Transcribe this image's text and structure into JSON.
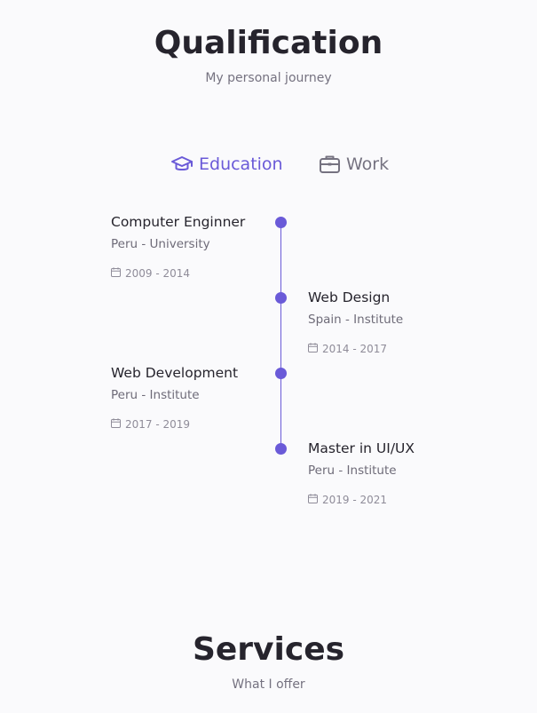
{
  "qualification": {
    "title": "Qualification",
    "subtitle": "My personal journey"
  },
  "tabs": [
    {
      "label": "Education",
      "icon": "graduation-cap-icon",
      "active": true
    },
    {
      "label": "Work",
      "icon": "briefcase-icon",
      "active": false
    }
  ],
  "timeline": [
    {
      "title": "Computer Enginner",
      "subtitle": "Peru - University",
      "date": "2009 - 2014",
      "side": "left"
    },
    {
      "title": "Web Design",
      "subtitle": "Spain - Institute",
      "date": "2014 - 2017",
      "side": "right"
    },
    {
      "title": "Web Development",
      "subtitle": "Peru - Institute",
      "date": "2017 - 2019",
      "side": "left"
    },
    {
      "title": "Master in UI/UX",
      "subtitle": "Peru - Institute",
      "date": "2019 - 2021",
      "side": "right"
    }
  ],
  "services": {
    "title": "Services",
    "subtitle": "What I offer"
  },
  "colors": {
    "accent": "#6a5ad8",
    "background": "#fafafc",
    "title": "#26242d",
    "muted": "#757280"
  }
}
